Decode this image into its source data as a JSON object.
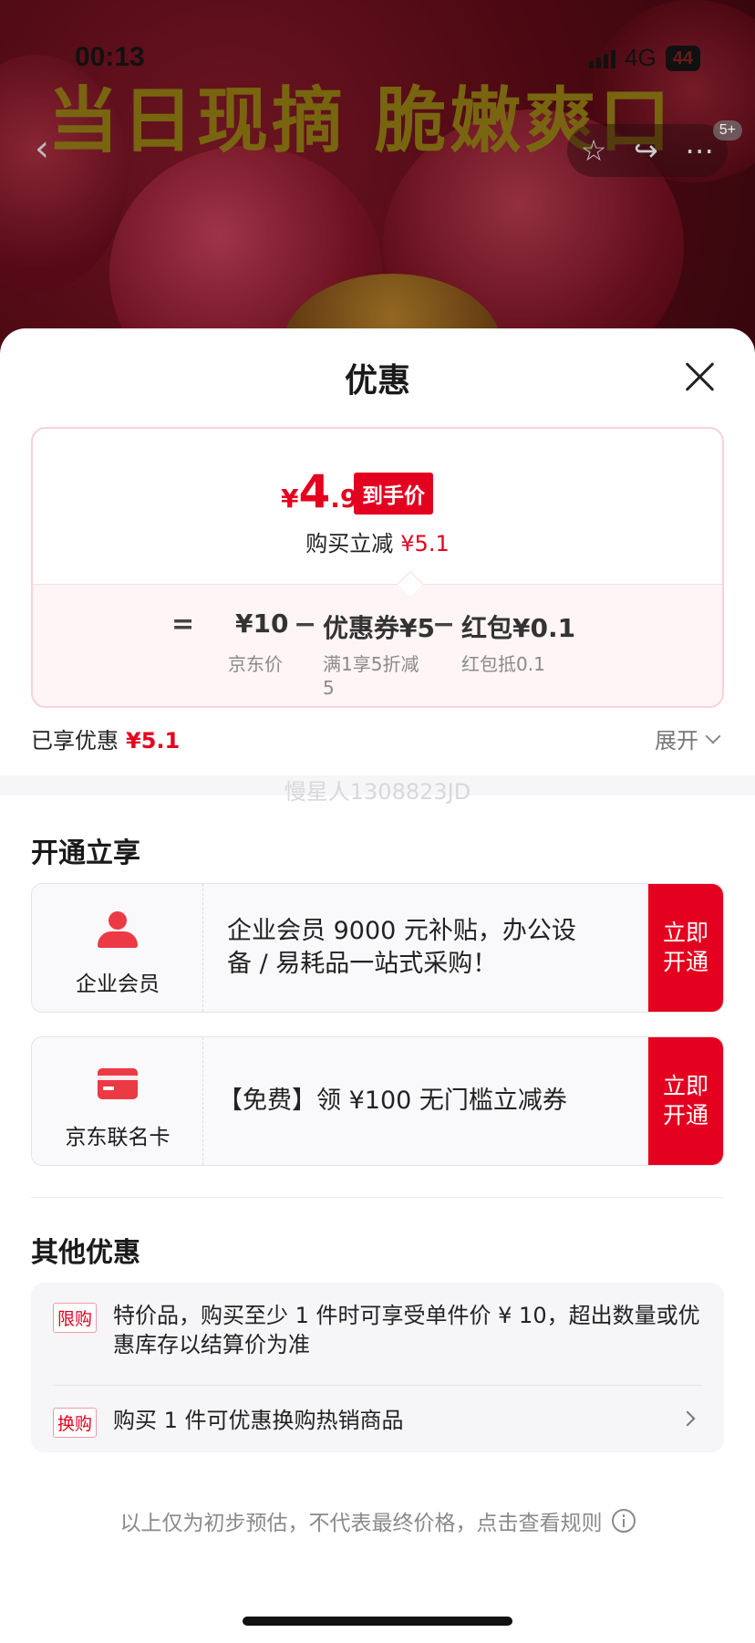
{
  "status_bar": {
    "time": "00:13",
    "network": "4G",
    "battery": "44"
  },
  "hero": {
    "headline": "当日现摘 脆嫩爽口",
    "cart_badge": "5+"
  },
  "sheet": {
    "title": "优惠",
    "price_card": {
      "currency": "¥",
      "final_int": "4",
      "final_dec": ".9",
      "final_tag": "到手价",
      "reduce_label": "购买立减",
      "reduce_value": "¥5.1",
      "formula": {
        "equals": "=",
        "minus": "−",
        "items": [
          {
            "value": "¥10",
            "sub": "京东价"
          },
          {
            "value": "优惠券¥5",
            "sub": "满1享5折减\n5"
          },
          {
            "value": "红包¥0.1",
            "sub": "红包抵0.1"
          }
        ]
      }
    },
    "enjoyed": {
      "label": "已享优惠",
      "value": "¥5.1"
    },
    "expand_label": "展开",
    "watermark": "慢星人1308823JD",
    "open_section": {
      "title": "开通立享",
      "cards": [
        {
          "name": "企业会员",
          "text": "企业会员 9000 元补贴，办公设备 / 易耗品一站式采购！",
          "button": "立即开通",
          "icon": "person-icon"
        },
        {
          "name": "京东联名卡",
          "text": "【免费】领 ¥100 无门槛立减券",
          "button": "立即开通",
          "icon": "card-icon"
        }
      ]
    },
    "other_section": {
      "title": "其他优惠",
      "items": [
        {
          "tag": "限购",
          "text": "特价品，购买至少 1 件时可享受单件价 ¥ 10，超出数量或优惠库存以结算价为准"
        },
        {
          "tag": "换购",
          "text": "购买 1 件可优惠换购热销商品"
        }
      ]
    },
    "footnote": "以上仅为初步预估，不代表最终价格，点击查看规则"
  },
  "colors": {
    "accent_red": "#e4001f",
    "card_border": "#f7d3d8"
  }
}
